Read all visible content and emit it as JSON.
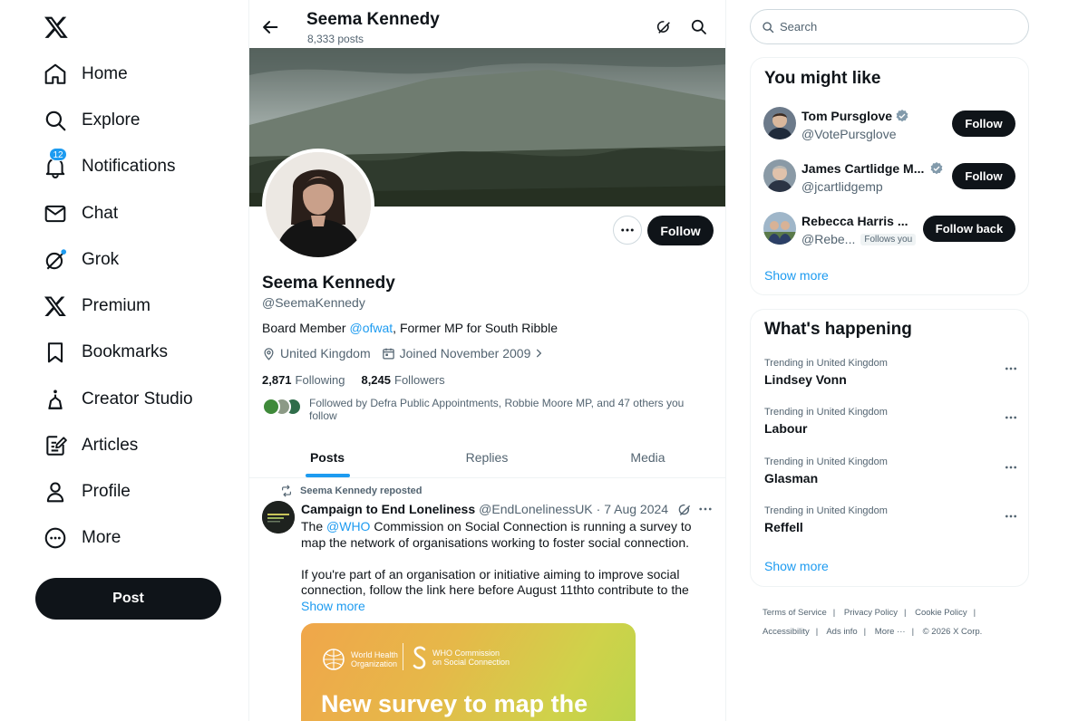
{
  "nav": {
    "items": [
      {
        "label": "Home",
        "icon": "home-icon"
      },
      {
        "label": "Explore",
        "icon": "search-icon"
      },
      {
        "label": "Notifications",
        "icon": "bell-icon",
        "badge": "12"
      },
      {
        "label": "Chat",
        "icon": "mail-icon"
      },
      {
        "label": "Grok",
        "icon": "grok-icon"
      },
      {
        "label": "Premium",
        "icon": "x-logo-icon"
      },
      {
        "label": "Bookmarks",
        "icon": "bookmark-icon"
      },
      {
        "label": "Creator Studio",
        "icon": "crown-icon"
      },
      {
        "label": "Articles",
        "icon": "article-icon"
      },
      {
        "label": "Profile",
        "icon": "person-icon"
      },
      {
        "label": "More",
        "icon": "more-circle-icon"
      }
    ],
    "post_label": "Post"
  },
  "header": {
    "name": "Seema Kennedy",
    "posts": "8,333 posts"
  },
  "profile": {
    "follow_label": "Follow",
    "name": "Seema Kennedy",
    "handle": "@SeemaKennedy",
    "bio_prefix": "Board Member ",
    "bio_mention": "@ofwat",
    "bio_suffix": ", Former MP for South Ribble",
    "location": "United Kingdom",
    "joined": "Joined November 2009",
    "following_count": "2,871",
    "following_label": "Following",
    "followers_count": "8,245",
    "followers_label": "Followers",
    "followed_by": "Followed by Defra Public Appointments, Robbie Moore MP, and 47 others you follow"
  },
  "tabs": [
    "Posts",
    "Replies",
    "Media"
  ],
  "tweet": {
    "repost_label": "Seema Kennedy reposted",
    "author_name": "Campaign to End Loneliness",
    "author_handle": "@EndLonelinessUK",
    "date": "· 7 Aug 2024",
    "text_pre": "The ",
    "text_mention": "@WHO",
    "text_post": " Commission on Social Connection is running a survey to map the network of organisations working to foster social connection.",
    "text_p2": "If you're part of an organisation or initiative aiming to improve social connection, follow the link here before August 11thto contribute to the",
    "show_more": "Show more",
    "card": {
      "who_line1": "World Health",
      "who_line2": "Organization",
      "comm_line1": "WHO Commission",
      "comm_line2": "on Social Connection",
      "title": "New survey to map the"
    }
  },
  "right": {
    "search_placeholder": "Search",
    "might_like_title": "You might like",
    "suggestions": [
      {
        "name": "Tom Pursglove",
        "handle": "@VotePursglove",
        "button": "Follow"
      },
      {
        "name": "James Cartlidge M...",
        "handle": "@jcartlidgemp",
        "button": "Follow"
      },
      {
        "name": "Rebecca Harris ...",
        "handle": "@Rebe...",
        "badge": "Follows you",
        "button": "Follow back"
      }
    ],
    "show_more": "Show more",
    "happening_title": "What's happening",
    "trends": [
      {
        "context": "Trending in United Kingdom",
        "name": "Lindsey Vonn"
      },
      {
        "context": "Trending in United Kingdom",
        "name": "Labour"
      },
      {
        "context": "Trending in United Kingdom",
        "name": "Glasman"
      },
      {
        "context": "Trending in United Kingdom",
        "name": "Reffell"
      }
    ],
    "show_more_2": "Show more"
  },
  "footer": {
    "terms": "Terms of Service",
    "privacy": "Privacy Policy",
    "cookie": "Cookie Policy",
    "accessibility": "Accessibility",
    "ads": "Ads info",
    "more": "More ···",
    "copyright": "© 2026 X Corp."
  },
  "colors": {
    "accent": "#1d9bf0",
    "text": "#0f1419",
    "muted": "#536471",
    "border": "#eff3f4"
  }
}
